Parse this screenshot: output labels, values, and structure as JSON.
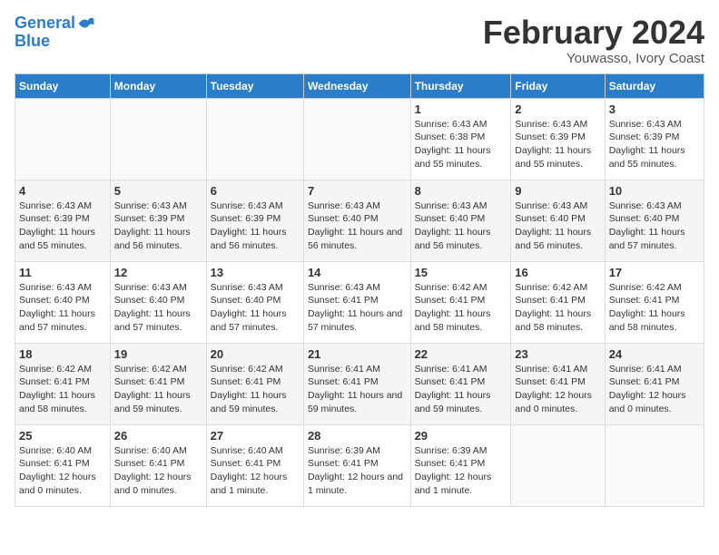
{
  "logo": {
    "line1": "General",
    "line2": "Blue"
  },
  "title": "February 2024",
  "subtitle": "Youwasso, Ivory Coast",
  "days_of_week": [
    "Sunday",
    "Monday",
    "Tuesday",
    "Wednesday",
    "Thursday",
    "Friday",
    "Saturday"
  ],
  "weeks": [
    [
      {
        "day": "",
        "info": ""
      },
      {
        "day": "",
        "info": ""
      },
      {
        "day": "",
        "info": ""
      },
      {
        "day": "",
        "info": ""
      },
      {
        "day": "1",
        "info": "Sunrise: 6:43 AM\nSunset: 6:38 PM\nDaylight: 11 hours and 55 minutes."
      },
      {
        "day": "2",
        "info": "Sunrise: 6:43 AM\nSunset: 6:39 PM\nDaylight: 11 hours and 55 minutes."
      },
      {
        "day": "3",
        "info": "Sunrise: 6:43 AM\nSunset: 6:39 PM\nDaylight: 11 hours and 55 minutes."
      }
    ],
    [
      {
        "day": "4",
        "info": "Sunrise: 6:43 AM\nSunset: 6:39 PM\nDaylight: 11 hours and 55 minutes."
      },
      {
        "day": "5",
        "info": "Sunrise: 6:43 AM\nSunset: 6:39 PM\nDaylight: 11 hours and 56 minutes."
      },
      {
        "day": "6",
        "info": "Sunrise: 6:43 AM\nSunset: 6:39 PM\nDaylight: 11 hours and 56 minutes."
      },
      {
        "day": "7",
        "info": "Sunrise: 6:43 AM\nSunset: 6:40 PM\nDaylight: 11 hours and 56 minutes."
      },
      {
        "day": "8",
        "info": "Sunrise: 6:43 AM\nSunset: 6:40 PM\nDaylight: 11 hours and 56 minutes."
      },
      {
        "day": "9",
        "info": "Sunrise: 6:43 AM\nSunset: 6:40 PM\nDaylight: 11 hours and 56 minutes."
      },
      {
        "day": "10",
        "info": "Sunrise: 6:43 AM\nSunset: 6:40 PM\nDaylight: 11 hours and 57 minutes."
      }
    ],
    [
      {
        "day": "11",
        "info": "Sunrise: 6:43 AM\nSunset: 6:40 PM\nDaylight: 11 hours and 57 minutes."
      },
      {
        "day": "12",
        "info": "Sunrise: 6:43 AM\nSunset: 6:40 PM\nDaylight: 11 hours and 57 minutes."
      },
      {
        "day": "13",
        "info": "Sunrise: 6:43 AM\nSunset: 6:40 PM\nDaylight: 11 hours and 57 minutes."
      },
      {
        "day": "14",
        "info": "Sunrise: 6:43 AM\nSunset: 6:41 PM\nDaylight: 11 hours and 57 minutes."
      },
      {
        "day": "15",
        "info": "Sunrise: 6:42 AM\nSunset: 6:41 PM\nDaylight: 11 hours and 58 minutes."
      },
      {
        "day": "16",
        "info": "Sunrise: 6:42 AM\nSunset: 6:41 PM\nDaylight: 11 hours and 58 minutes."
      },
      {
        "day": "17",
        "info": "Sunrise: 6:42 AM\nSunset: 6:41 PM\nDaylight: 11 hours and 58 minutes."
      }
    ],
    [
      {
        "day": "18",
        "info": "Sunrise: 6:42 AM\nSunset: 6:41 PM\nDaylight: 11 hours and 58 minutes."
      },
      {
        "day": "19",
        "info": "Sunrise: 6:42 AM\nSunset: 6:41 PM\nDaylight: 11 hours and 59 minutes."
      },
      {
        "day": "20",
        "info": "Sunrise: 6:42 AM\nSunset: 6:41 PM\nDaylight: 11 hours and 59 minutes."
      },
      {
        "day": "21",
        "info": "Sunrise: 6:41 AM\nSunset: 6:41 PM\nDaylight: 11 hours and 59 minutes."
      },
      {
        "day": "22",
        "info": "Sunrise: 6:41 AM\nSunset: 6:41 PM\nDaylight: 11 hours and 59 minutes."
      },
      {
        "day": "23",
        "info": "Sunrise: 6:41 AM\nSunset: 6:41 PM\nDaylight: 12 hours and 0 minutes."
      },
      {
        "day": "24",
        "info": "Sunrise: 6:41 AM\nSunset: 6:41 PM\nDaylight: 12 hours and 0 minutes."
      }
    ],
    [
      {
        "day": "25",
        "info": "Sunrise: 6:40 AM\nSunset: 6:41 PM\nDaylight: 12 hours and 0 minutes."
      },
      {
        "day": "26",
        "info": "Sunrise: 6:40 AM\nSunset: 6:41 PM\nDaylight: 12 hours and 0 minutes."
      },
      {
        "day": "27",
        "info": "Sunrise: 6:40 AM\nSunset: 6:41 PM\nDaylight: 12 hours and 1 minute."
      },
      {
        "day": "28",
        "info": "Sunrise: 6:39 AM\nSunset: 6:41 PM\nDaylight: 12 hours and 1 minute."
      },
      {
        "day": "29",
        "info": "Sunrise: 6:39 AM\nSunset: 6:41 PM\nDaylight: 12 hours and 1 minute."
      },
      {
        "day": "",
        "info": ""
      },
      {
        "day": "",
        "info": ""
      }
    ]
  ]
}
